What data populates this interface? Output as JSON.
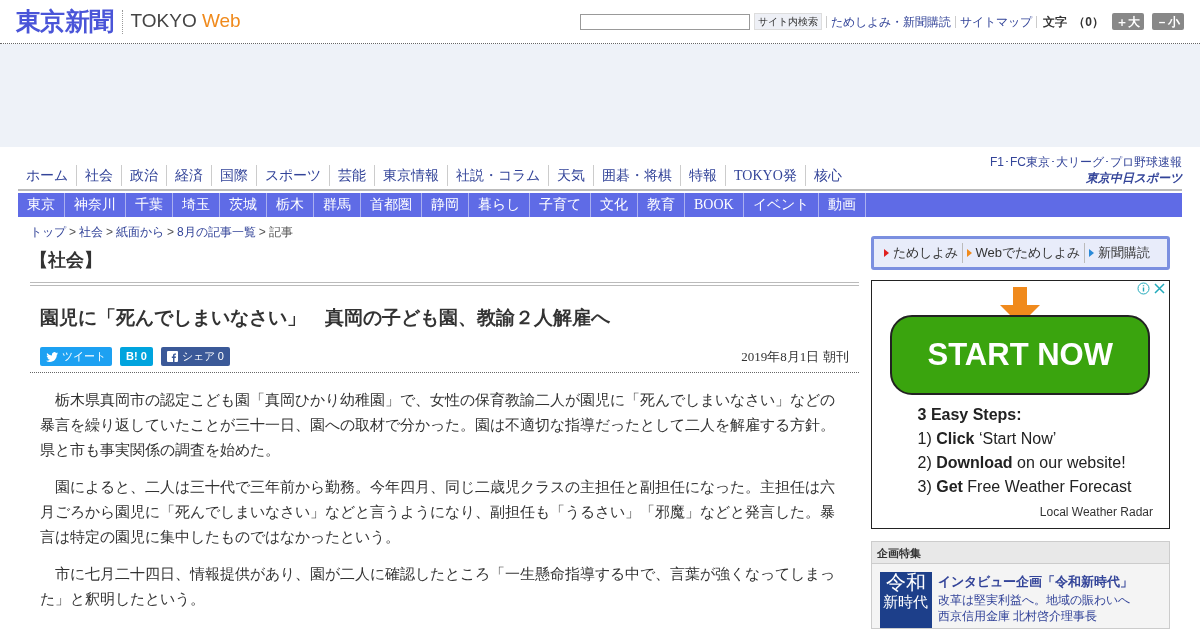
{
  "header": {
    "logo": "東京新聞",
    "brand": "TOKYO",
    "brand_accent": "Web",
    "search": {
      "button": "サイト内検索"
    },
    "links": [
      "ためしよみ・新聞購読",
      "サイトマップ"
    ],
    "text_size": {
      "label": "文字",
      "value": "（0）",
      "buttons": [
        "＋大",
        "－小"
      ]
    }
  },
  "nav": {
    "items": [
      "ホーム",
      "社会",
      "政治",
      "経済",
      "国際",
      "スポーツ",
      "芸能",
      "東京情報",
      "社説・コラム",
      "天気",
      "囲碁・将棋",
      "特報",
      "TOKYO発",
      "核心"
    ],
    "promo": {
      "caption": "F1･FC東京･大リーグ･プロ野球速報",
      "name": "東京中日スポーツ"
    }
  },
  "subnav": [
    "東京",
    "神奈川",
    "千葉",
    "埼玉",
    "茨城",
    "栃木",
    "群馬",
    "首都圏",
    "静岡",
    "暮らし",
    "子育て",
    "文化",
    "教育",
    "BOOK",
    "イベント",
    "動画"
  ],
  "breadcrumb": {
    "separator": ">",
    "items": [
      "トップ",
      "社会",
      "紙面から",
      "8月の記事一覧",
      "記事"
    ]
  },
  "section": "【社会】",
  "article": {
    "title": "園児に「死んでしまいなさい」　真岡の子ども園、教諭２人解雇へ",
    "share": [
      {
        "kind": "twitter",
        "label": "ツイート"
      },
      {
        "kind": "hatena",
        "label": "B! 0"
      },
      {
        "kind": "facebook",
        "label": "シェア 0"
      }
    ],
    "date": "2019年8月1日 朝刊",
    "paragraphs": [
      "栃木県真岡市の認定こども園「真岡ひかり幼稚園」で、女性の保育教諭二人が園児に「死んでしまいなさい」などの暴言を繰り返していたことが三十一日、園への取材で分かった。園は不適切な指導だったとして二人を解雇する方針。県と市も事実関係の調査を始めた。",
      "園によると、二人は三十代で三年前から勤務。今年四月、同じ二歳児クラスの主担任と副担任になった。主担任は六月ごろから園児に「死んでしまいなさい」などと言うようになり、副担任も「うるさい」「邪魔」などと発言した。暴言は特定の園児に集中したものではなかったという。",
      "市に七月二十四日、情報提供があり、園が二人に確認したところ「一生懸命指導する中で、言葉が強くなってしまった」と釈明したという。"
    ]
  },
  "sidebar": {
    "links": [
      {
        "label": "ためしよみ",
        "color": "#e02020"
      },
      {
        "label": "Webでためしよみ",
        "color": "#f08a1c"
      },
      {
        "label": "新聞購読",
        "color": "#2a8ad8"
      }
    ],
    "ad": {
      "button": "START NOW",
      "steps_title": "3 Easy Steps:",
      "steps": [
        "1) **Click** ‘Start Now’",
        "2) **Download** on our website!",
        "3) **Get** Free Weather Forecast"
      ],
      "sponsor": "Local Weather Radar"
    },
    "feature": {
      "heading": "企画特集",
      "thumb": [
        "令和",
        "新時代"
      ],
      "title": "インタビュー企画「令和新時代」",
      "lines": [
        "改革は堅実利益へ。地域の賑わいへ",
        "西京信用金庫 北村啓介理事長"
      ]
    }
  }
}
